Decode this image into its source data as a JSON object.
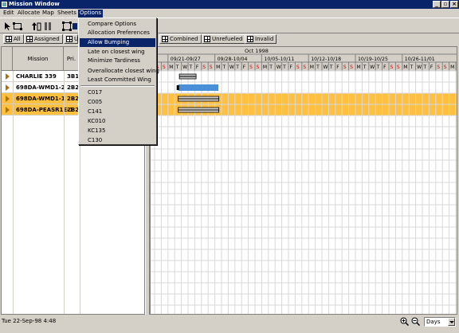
{
  "window": {
    "title": "Mission Window"
  },
  "menubar": [
    "Edit",
    "Allocate",
    "Map",
    "Sheets",
    "Options"
  ],
  "options_menu": {
    "group1": [
      "Compare Options",
      "Allocation Preferences",
      "Allow Bumping",
      "Late on closest wing",
      "Minimize Tardiness",
      "Overallocate closest wing",
      "Least Committed Wing"
    ],
    "selected": "Allow Bumping",
    "aircraft": [
      "C017",
      "C005",
      "C141",
      "KC010",
      "KC135",
      "C130"
    ]
  },
  "filters": [
    "All",
    "Assigned",
    "U",
    "Combined",
    "Unrefueled",
    "Invalid"
  ],
  "table": {
    "headers": {
      "mission": "Mission",
      "priority": "Pri."
    },
    "rows": [
      {
        "mission": "CHARLIE 339",
        "priority": "3B1",
        "highlight": false
      },
      {
        "mission": "698DA-WMD1-2",
        "priority": "2B2",
        "highlight": false
      },
      {
        "mission": "698DA-WMD1-1",
        "priority": "2B2",
        "highlight": true
      },
      {
        "mission": "698DA-PEASR1E-1",
        "priority": "2B2",
        "highlight": true
      }
    ]
  },
  "timeline": {
    "month": "Oct 1998",
    "weeks": [
      "09/21-09/27",
      "09/28-10/04",
      "10/05-10/11",
      "10/12-10/18",
      "10/19-10/25",
      "10/26-11/01"
    ],
    "day_letters": [
      "S",
      "S",
      "M",
      "T",
      "W",
      "T",
      "F",
      "S",
      "S",
      "M",
      "T",
      "W",
      "T",
      "F",
      "S",
      "S",
      "M",
      "T",
      "W",
      "T",
      "F",
      "S",
      "S",
      "M",
      "T",
      "W",
      "T",
      "F",
      "S",
      "S",
      "M",
      "T",
      "W",
      "T",
      "F",
      "S",
      "S",
      "M",
      "T",
      "W",
      "T",
      "F",
      "S",
      "S",
      "M",
      "T",
      "W",
      "T",
      "F",
      "S",
      "S",
      "M",
      "T",
      "W",
      "T",
      "F",
      "S",
      "S",
      "M"
    ],
    "colors": {
      "weekend": "#d00000",
      "highlight_row": "#ffc040",
      "blue_bar": "#4a90d9"
    }
  },
  "status": {
    "datetime": "Tue 22-Sep-98 4:48",
    "units": "Days"
  },
  "icons": [
    "zoom-in-icon",
    "zoom-out-icon",
    "grid-icon"
  ]
}
